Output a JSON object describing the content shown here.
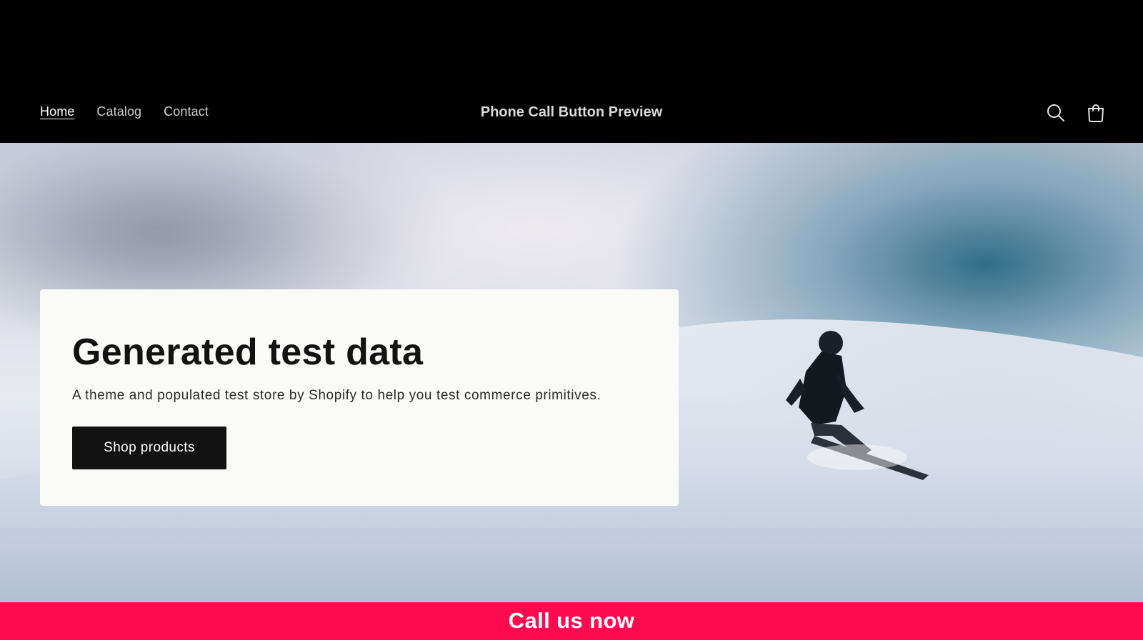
{
  "header": {
    "nav": [
      {
        "label": "Home",
        "active": true
      },
      {
        "label": "Catalog",
        "active": false
      },
      {
        "label": "Contact",
        "active": false
      }
    ],
    "store_title": "Phone Call Button Preview",
    "icons": [
      "search-icon",
      "cart-icon"
    ]
  },
  "hero": {
    "title": "Generated test data",
    "subtitle": "A theme and populated test store by Shopify to help you test commerce primitives.",
    "button_label": "Shop products"
  },
  "call_bar": {
    "label": "Call us now",
    "color": "#ff0a4e"
  },
  "colors": {
    "header_bg": "#000000",
    "button_bg": "#121212",
    "card_bg": "#fafaf8"
  }
}
